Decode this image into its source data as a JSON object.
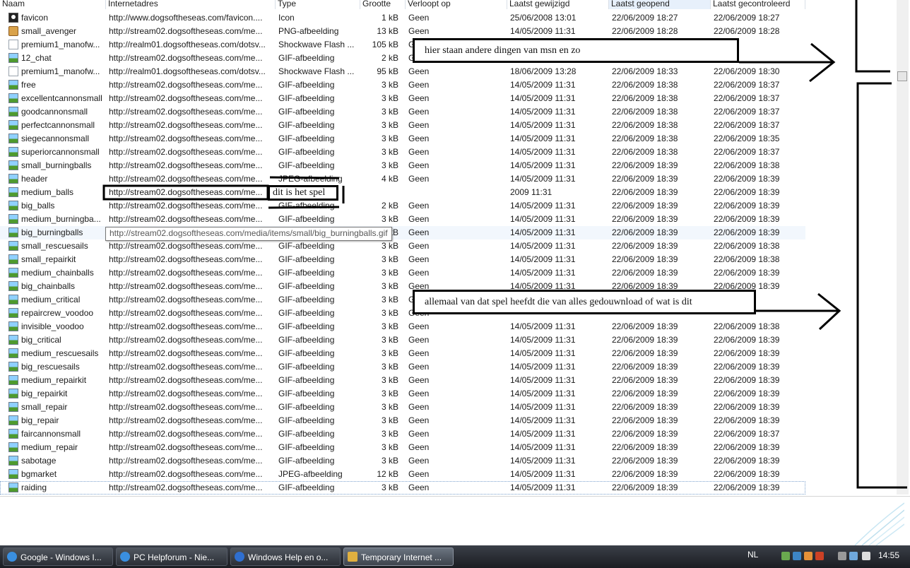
{
  "columns": [
    "Naam",
    "Internetadres",
    "Type",
    "Grootte",
    "Verloopt op",
    "Laatst gewijzigd",
    "Laatst geopend",
    "Laatst gecontroleerd"
  ],
  "rows": [
    {
      "icon": "icon",
      "name": "favicon",
      "url": "http://www.dogsoftheseas.com/favicon....",
      "type": "Icon",
      "size": "1 kB",
      "expires": "Geen",
      "modified": "25/06/2008 13:01",
      "accessed": "22/06/2009 18:27",
      "checked": "22/06/2009 18:27"
    },
    {
      "icon": "png",
      "name": "small_avenger",
      "url": "http://stream02.dogsoftheseas.com/me...",
      "type": "PNG-afbeelding",
      "size": "13 kB",
      "expires": "Geen",
      "modified": "14/05/2009 11:31",
      "accessed": "22/06/2009 18:28",
      "checked": "22/06/2009 18:28"
    },
    {
      "icon": "doc",
      "name": "premium1_manofw...",
      "url": "http://realm01.dogsoftheseas.com/dotsv...",
      "type": "Shockwave Flash ...",
      "size": "105 kB",
      "expires": "Geen",
      "modified": "",
      "accessed": "",
      "checked": ""
    },
    {
      "icon": "img",
      "name": "12_chat",
      "url": "http://stream02.dogsoftheseas.com/me...",
      "type": "GIF-afbeelding",
      "size": "2 kB",
      "expires": "G",
      "modified": "",
      "accessed": "",
      "checked": ""
    },
    {
      "icon": "doc",
      "name": "premium1_manofw...",
      "url": "http://realm01.dogsoftheseas.com/dotsv...",
      "type": "Shockwave Flash ...",
      "size": "95 kB",
      "expires": "Geen",
      "modified": "18/06/2009 13:28",
      "accessed": "22/06/2009 18:33",
      "checked": "22/06/2009 18:30"
    },
    {
      "icon": "img",
      "name": "free",
      "url": "http://stream02.dogsoftheseas.com/me...",
      "type": "GIF-afbeelding",
      "size": "3 kB",
      "expires": "Geen",
      "modified": "14/05/2009 11:31",
      "accessed": "22/06/2009 18:38",
      "checked": "22/06/2009 18:37"
    },
    {
      "icon": "img",
      "name": "excellentcannonsmall",
      "url": "http://stream02.dogsoftheseas.com/me...",
      "type": "GIF-afbeelding",
      "size": "3 kB",
      "expires": "Geen",
      "modified": "14/05/2009 11:31",
      "accessed": "22/06/2009 18:38",
      "checked": "22/06/2009 18:37"
    },
    {
      "icon": "img",
      "name": "goodcannonsmall",
      "url": "http://stream02.dogsoftheseas.com/me...",
      "type": "GIF-afbeelding",
      "size": "3 kB",
      "expires": "Geen",
      "modified": "14/05/2009 11:31",
      "accessed": "22/06/2009 18:38",
      "checked": "22/06/2009 18:37"
    },
    {
      "icon": "img",
      "name": "perfectcannonsmall",
      "url": "http://stream02.dogsoftheseas.com/me...",
      "type": "GIF-afbeelding",
      "size": "3 kB",
      "expires": "Geen",
      "modified": "14/05/2009 11:31",
      "accessed": "22/06/2009 18:38",
      "checked": "22/06/2009 18:37"
    },
    {
      "icon": "img",
      "name": "siegecannonsmall",
      "url": "http://stream02.dogsoftheseas.com/me...",
      "type": "GIF-afbeelding",
      "size": "3 kB",
      "expires": "Geen",
      "modified": "14/05/2009 11:31",
      "accessed": "22/06/2009 18:38",
      "checked": "22/06/2009 18:35"
    },
    {
      "icon": "img",
      "name": "superiorcannonsmall",
      "url": "http://stream02.dogsoftheseas.com/me...",
      "type": "GIF-afbeelding",
      "size": "3 kB",
      "expires": "Geen",
      "modified": "14/05/2009 11:31",
      "accessed": "22/06/2009 18:38",
      "checked": "22/06/2009 18:37"
    },
    {
      "icon": "img",
      "name": "small_burningballs",
      "url": "http://stream02.dogsoftheseas.com/me...",
      "type": "GIF-afbeelding",
      "size": "3 kB",
      "expires": "Geen",
      "modified": "14/05/2009 11:31",
      "accessed": "22/06/2009 18:39",
      "checked": "22/06/2009 18:38"
    },
    {
      "icon": "img",
      "name": "header",
      "url": "http://stream02.dogsoftheseas.com/me...",
      "type": "JPEG-afbeelding",
      "size": "4 kB",
      "expires": "Geen",
      "modified": "14/05/2009 11:31",
      "accessed": "22/06/2009 18:39",
      "checked": "22/06/2009 18:39"
    },
    {
      "icon": "img",
      "name": "medium_balls",
      "url": "http://stream02.dogsoftheseas.com/me...",
      "type": "",
      "size": "",
      "expires": "",
      "modified": "2009 11:31",
      "accessed": "22/06/2009 18:39",
      "checked": "22/06/2009 18:39"
    },
    {
      "icon": "img",
      "name": "big_balls",
      "url": "http://stream02.dogsoftheseas.com/me...",
      "type": "GIF-afbeelding",
      "size": "2 kB",
      "expires": "Geen",
      "modified": "14/05/2009 11:31",
      "accessed": "22/06/2009 18:39",
      "checked": "22/06/2009 18:39"
    },
    {
      "icon": "img",
      "name": "medium_burningba...",
      "url": "http://stream02.dogsoftheseas.com/me...",
      "type": "GIF-afbeelding",
      "size": "3 kB",
      "expires": "Geen",
      "modified": "14/05/2009 11:31",
      "accessed": "22/06/2009 18:39",
      "checked": "22/06/2009 18:39"
    },
    {
      "icon": "img",
      "name": "big_burningballs",
      "url": "",
      "type": "",
      "size": "3 kB",
      "expires": "Geen",
      "modified": "14/05/2009 11:31",
      "accessed": "22/06/2009 18:39",
      "checked": "22/06/2009 18:39"
    },
    {
      "icon": "img",
      "name": "small_rescuesails",
      "url": "http://stream02.dogsoftheseas.com/me...",
      "type": "GIF-afbeelding",
      "size": "3 kB",
      "expires": "Geen",
      "modified": "14/05/2009 11:31",
      "accessed": "22/06/2009 18:39",
      "checked": "22/06/2009 18:38"
    },
    {
      "icon": "img",
      "name": "small_repairkit",
      "url": "http://stream02.dogsoftheseas.com/me...",
      "type": "GIF-afbeelding",
      "size": "3 kB",
      "expires": "Geen",
      "modified": "14/05/2009 11:31",
      "accessed": "22/06/2009 18:39",
      "checked": "22/06/2009 18:38"
    },
    {
      "icon": "img",
      "name": "medium_chainballs",
      "url": "http://stream02.dogsoftheseas.com/me...",
      "type": "GIF-afbeelding",
      "size": "3 kB",
      "expires": "Geen",
      "modified": "14/05/2009 11:31",
      "accessed": "22/06/2009 18:39",
      "checked": "22/06/2009 18:39"
    },
    {
      "icon": "img",
      "name": "big_chainballs",
      "url": "http://stream02.dogsoftheseas.com/me...",
      "type": "GIF-afbeelding",
      "size": "3 kB",
      "expires": "Geen",
      "modified": "14/05/2009 11:31",
      "accessed": "22/06/2009 18:39",
      "checked": "22/06/2009 18:39"
    },
    {
      "icon": "img",
      "name": "medium_critical",
      "url": "http://stream02.dogsoftheseas.com/me...",
      "type": "GIF-afbeelding",
      "size": "3 kB",
      "expires": "Ge",
      "modified": "",
      "accessed": "",
      "checked": ""
    },
    {
      "icon": "img",
      "name": "repaircrew_voodoo",
      "url": "http://stream02.dogsoftheseas.com/me...",
      "type": "GIF-afbeelding",
      "size": "3 kB",
      "expires": "Geen",
      "modified": "",
      "accessed": "",
      "checked": ""
    },
    {
      "icon": "img",
      "name": "invisible_voodoo",
      "url": "http://stream02.dogsoftheseas.com/me...",
      "type": "GIF-afbeelding",
      "size": "3 kB",
      "expires": "Geen",
      "modified": "14/05/2009 11:31",
      "accessed": "22/06/2009 18:39",
      "checked": "22/06/2009 18:38"
    },
    {
      "icon": "img",
      "name": "big_critical",
      "url": "http://stream02.dogsoftheseas.com/me...",
      "type": "GIF-afbeelding",
      "size": "3 kB",
      "expires": "Geen",
      "modified": "14/05/2009 11:31",
      "accessed": "22/06/2009 18:39",
      "checked": "22/06/2009 18:39"
    },
    {
      "icon": "img",
      "name": "medium_rescuesails",
      "url": "http://stream02.dogsoftheseas.com/me...",
      "type": "GIF-afbeelding",
      "size": "3 kB",
      "expires": "Geen",
      "modified": "14/05/2009 11:31",
      "accessed": "22/06/2009 18:39",
      "checked": "22/06/2009 18:39"
    },
    {
      "icon": "img",
      "name": "big_rescuesails",
      "url": "http://stream02.dogsoftheseas.com/me...",
      "type": "GIF-afbeelding",
      "size": "3 kB",
      "expires": "Geen",
      "modified": "14/05/2009 11:31",
      "accessed": "22/06/2009 18:39",
      "checked": "22/06/2009 18:39"
    },
    {
      "icon": "img",
      "name": "medium_repairkit",
      "url": "http://stream02.dogsoftheseas.com/me...",
      "type": "GIF-afbeelding",
      "size": "3 kB",
      "expires": "Geen",
      "modified": "14/05/2009 11:31",
      "accessed": "22/06/2009 18:39",
      "checked": "22/06/2009 18:39"
    },
    {
      "icon": "img",
      "name": "big_repairkit",
      "url": "http://stream02.dogsoftheseas.com/me...",
      "type": "GIF-afbeelding",
      "size": "3 kB",
      "expires": "Geen",
      "modified": "14/05/2009 11:31",
      "accessed": "22/06/2009 18:39",
      "checked": "22/06/2009 18:39"
    },
    {
      "icon": "img",
      "name": "small_repair",
      "url": "http://stream02.dogsoftheseas.com/me...",
      "type": "GIF-afbeelding",
      "size": "3 kB",
      "expires": "Geen",
      "modified": "14/05/2009 11:31",
      "accessed": "22/06/2009 18:39",
      "checked": "22/06/2009 18:39"
    },
    {
      "icon": "img",
      "name": "big_repair",
      "url": "http://stream02.dogsoftheseas.com/me...",
      "type": "GIF-afbeelding",
      "size": "3 kB",
      "expires": "Geen",
      "modified": "14/05/2009 11:31",
      "accessed": "22/06/2009 18:39",
      "checked": "22/06/2009 18:39"
    },
    {
      "icon": "img",
      "name": "faircannonsmall",
      "url": "http://stream02.dogsoftheseas.com/me...",
      "type": "GIF-afbeelding",
      "size": "3 kB",
      "expires": "Geen",
      "modified": "14/05/2009 11:31",
      "accessed": "22/06/2009 18:39",
      "checked": "22/06/2009 18:37"
    },
    {
      "icon": "img",
      "name": "medium_repair",
      "url": "http://stream02.dogsoftheseas.com/me...",
      "type": "GIF-afbeelding",
      "size": "3 kB",
      "expires": "Geen",
      "modified": "14/05/2009 11:31",
      "accessed": "22/06/2009 18:39",
      "checked": "22/06/2009 18:39"
    },
    {
      "icon": "img",
      "name": "sabotage",
      "url": "http://stream02.dogsoftheseas.com/me...",
      "type": "GIF-afbeelding",
      "size": "3 kB",
      "expires": "Geen",
      "modified": "14/05/2009 11:31",
      "accessed": "22/06/2009 18:39",
      "checked": "22/06/2009 18:39"
    },
    {
      "icon": "img",
      "name": "bgmarket",
      "url": "http://stream02.dogsoftheseas.com/me...",
      "type": "JPEG-afbeelding",
      "size": "12 kB",
      "expires": "Geen",
      "modified": "14/05/2009 11:31",
      "accessed": "22/06/2009 18:39",
      "checked": "22/06/2009 18:39"
    },
    {
      "icon": "img",
      "name": "raiding",
      "url": "http://stream02.dogsoftheseas.com/me...",
      "type": "GIF-afbeelding",
      "size": "3 kB",
      "expires": "Geen",
      "modified": "14/05/2009 11:31",
      "accessed": "22/06/2009 18:39",
      "checked": "22/06/2009 18:39"
    }
  ],
  "tooltip": "http://stream02.dogsoftheseas.com/media/items/small/big_burningballs.gif",
  "annotations": {
    "top": "hier staan andere dingen van msn en zo",
    "middle": "dit is het spel",
    "bottom": "allemaal van dat spel  heefdt die van alles gedouwnload of wat is dit"
  },
  "taskbar": {
    "tasks": [
      "Google - Windows I...",
      "PC Helpforum - Nie...",
      "Windows Help en o...",
      "Temporary Internet ..."
    ],
    "language": "NL",
    "clock": "14:55"
  }
}
